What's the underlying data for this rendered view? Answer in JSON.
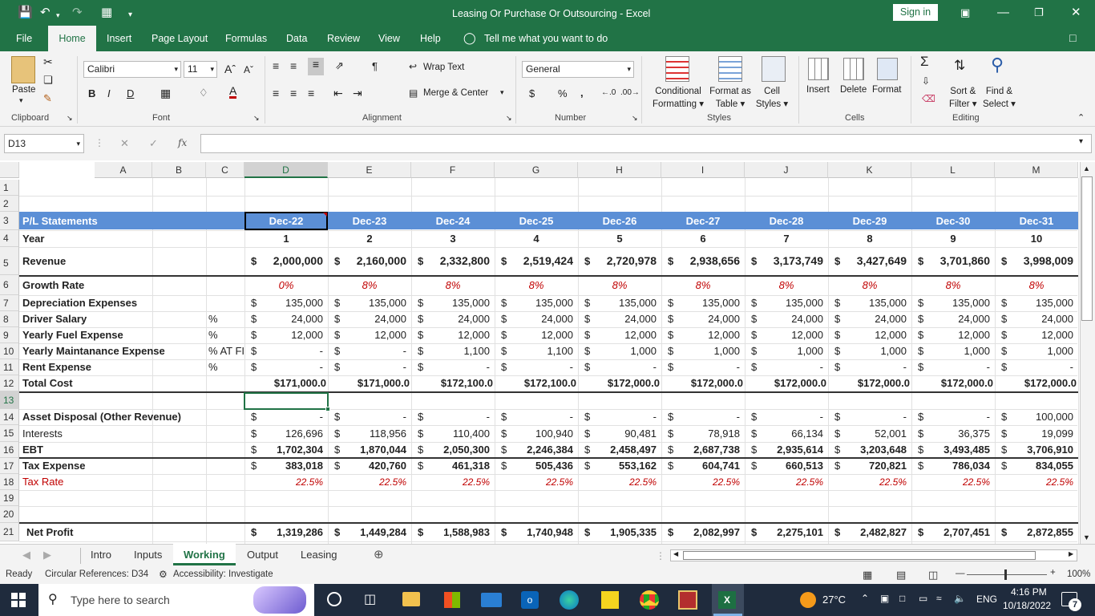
{
  "window": {
    "title": "Leasing Or Purchase Or Outsourcing  -  Excel",
    "signin": "Sign in"
  },
  "ribbon_tabs": [
    "File",
    "Home",
    "Insert",
    "Page Layout",
    "Formulas",
    "Data",
    "Review",
    "View",
    "Help"
  ],
  "tell_me": "Tell me what you want to do",
  "clipboard": {
    "paste": "Paste",
    "label": "Clipboard"
  },
  "font": {
    "name": "Calibri",
    "size": "11",
    "bold": "B",
    "italic": "I",
    "underline": "D",
    "label": "Font"
  },
  "alignment": {
    "wrap": "Wrap Text",
    "merge": "Merge & Center",
    "label": "Alignment"
  },
  "number": {
    "format": "General",
    "currency": "$",
    "percent": "%",
    "comma": ",",
    "label": "Number"
  },
  "styles": {
    "conditional": [
      "Conditional",
      "Formatting"
    ],
    "format_table": [
      "Format as",
      "Table"
    ],
    "cell_styles": [
      "Cell",
      "Styles"
    ],
    "label": "Styles"
  },
  "cells": {
    "insert": "Insert",
    "delete": "Delete",
    "format": "Format",
    "label": "Cells"
  },
  "editing": {
    "sort": [
      "Sort &",
      "Filter"
    ],
    "find": [
      "Find &",
      "Select"
    ],
    "sum": "Σ",
    "label": "Editing"
  },
  "formula_bar": {
    "name_box": "D13",
    "fx": "fx",
    "content": ""
  },
  "columns": [
    "A",
    "B",
    "C",
    "D",
    "E",
    "F",
    "G",
    "H",
    "I",
    "J",
    "K",
    "L",
    "M"
  ],
  "rows": [
    "1",
    "2",
    "3",
    "4",
    "5",
    "6",
    "7",
    "8",
    "9",
    "10",
    "11",
    "12",
    "13",
    "14",
    "15",
    "16",
    "17",
    "18",
    "19",
    "20",
    "21"
  ],
  "sheet": {
    "header_label": "P/L Statements",
    "periods": [
      "Dec-22",
      "Dec-23",
      "Dec-24",
      "Dec-25",
      "Dec-26",
      "Dec-27",
      "Dec-28",
      "Dec-29",
      "Dec-30",
      "Dec-31"
    ],
    "year_label": "Year",
    "years": [
      "1",
      "2",
      "3",
      "4",
      "5",
      "6",
      "7",
      "8",
      "9",
      "10"
    ],
    "revenue_label": "Revenue",
    "revenue": [
      "2,000,000",
      "2,160,000",
      "2,332,800",
      "2,519,424",
      "2,720,978",
      "2,938,656",
      "3,173,749",
      "3,427,649",
      "3,701,860",
      "3,998,009"
    ],
    "growth_label": "Growth Rate",
    "growth": [
      "0%",
      "8%",
      "8%",
      "8%",
      "8%",
      "8%",
      "8%",
      "8%",
      "8%",
      "8%"
    ],
    "lines": [
      {
        "label": "Depreciation Expenses",
        "unit": "",
        "values": [
          "135,000",
          "135,000",
          "135,000",
          "135,000",
          "135,000",
          "135,000",
          "135,000",
          "135,000",
          "135,000",
          "135,000"
        ]
      },
      {
        "label": "Driver Salary",
        "unit": "%",
        "values": [
          "24,000",
          "24,000",
          "24,000",
          "24,000",
          "24,000",
          "24,000",
          "24,000",
          "24,000",
          "24,000",
          "24,000"
        ]
      },
      {
        "label": "Yearly Fuel Expense",
        "unit": "%",
        "values": [
          "12,000",
          "12,000",
          "12,000",
          "12,000",
          "12,000",
          "12,000",
          "12,000",
          "12,000",
          "12,000",
          "12,000"
        ]
      },
      {
        "label": "Yearly Maintanance Expense",
        "unit": "% AT FI",
        "values": [
          "-",
          "-",
          "1,100",
          "1,100",
          "1,000",
          "1,000",
          "1,000",
          "1,000",
          "1,000",
          "1,000"
        ]
      },
      {
        "label": "Rent Expense",
        "unit": "%",
        "values": [
          "-",
          "-",
          "-",
          "-",
          "-",
          "-",
          "-",
          "-",
          "-",
          "-"
        ]
      }
    ],
    "total_label": "Total Cost",
    "total": [
      "$171,000.0",
      "$171,000.0",
      "$172,100.0",
      "$172,100.0",
      "$172,000.0",
      "$172,000.0",
      "$172,000.0",
      "$172,000.0",
      "$172,000.0",
      "$172,000.0"
    ],
    "lines2": [
      {
        "label": "Asset Disposal (Other Revenue)",
        "values": [
          "-",
          "-",
          "-",
          "-",
          "-",
          "-",
          "-",
          "-",
          "-",
          "100,000"
        ]
      },
      {
        "label": "Interests",
        "values": [
          "126,696",
          "118,956",
          "110,400",
          "100,940",
          "90,481",
          "78,918",
          "66,134",
          "52,001",
          "36,375",
          "19,099"
        ]
      },
      {
        "label": "EBT",
        "values": [
          "1,702,304",
          "1,870,044",
          "2,050,300",
          "2,246,384",
          "2,458,497",
          "2,687,738",
          "2,935,614",
          "3,203,648",
          "3,493,485",
          "3,706,910"
        ]
      },
      {
        "label": "Tax Expense",
        "values": [
          "383,018",
          "420,760",
          "461,318",
          "505,436",
          "553,162",
          "604,741",
          "660,513",
          "720,821",
          "786,034",
          "834,055"
        ]
      }
    ],
    "tax_rate_label": "Tax Rate",
    "tax_rate": [
      "22.5%",
      "22.5%",
      "22.5%",
      "22.5%",
      "22.5%",
      "22.5%",
      "22.5%",
      "22.5%",
      "22.5%",
      "22.5%"
    ],
    "net_label": "Net Profit",
    "net": [
      "1,319,286",
      "1,449,284",
      "1,588,983",
      "1,740,948",
      "1,905,335",
      "2,082,997",
      "2,275,101",
      "2,482,827",
      "2,707,451",
      "2,872,855"
    ],
    "currency": "$"
  },
  "sheet_tabs": [
    "Intro",
    "Inputs",
    "Working",
    "Output",
    "Leasing"
  ],
  "status": {
    "ready": "Ready",
    "circular": "Circular References: D34",
    "accessibility": "Accessibility: Investigate",
    "zoom": "100%"
  },
  "taskbar": {
    "search": "Type here to search",
    "temp": "27°C",
    "lang": "ENG",
    "time": "4:16 PM",
    "date": "10/18/2022",
    "notif": "7"
  },
  "colors": {
    "excel_green": "#217346",
    "header_blue": "#5b8fd6",
    "red_text": "#c00000"
  }
}
